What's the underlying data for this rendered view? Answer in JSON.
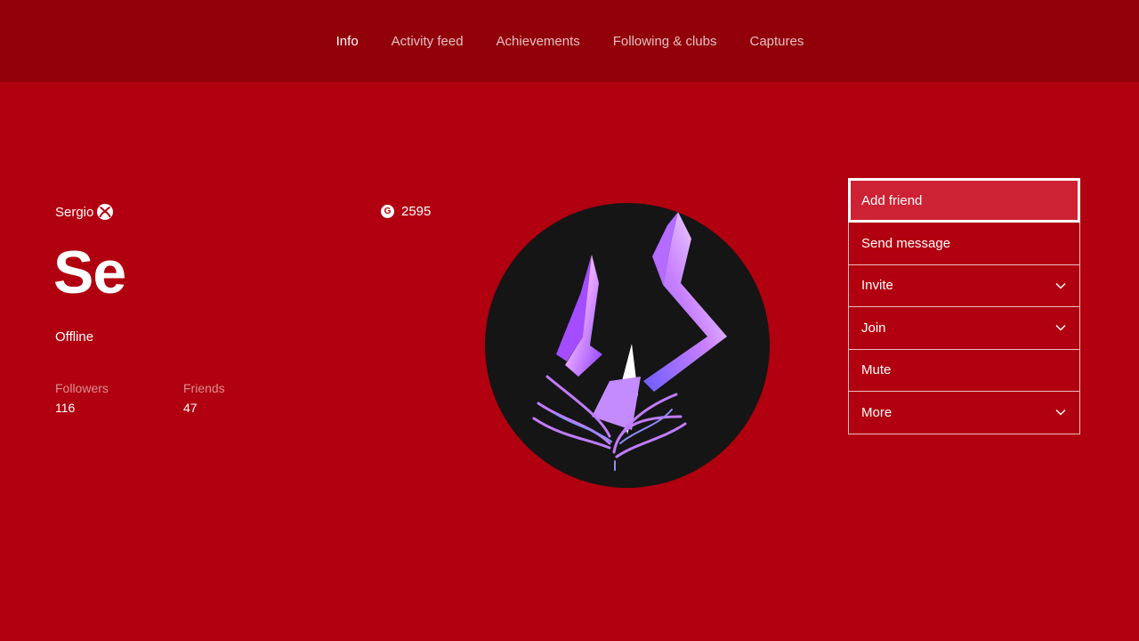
{
  "nav": {
    "tabs": [
      {
        "label": "Info",
        "active": true
      },
      {
        "label": "Activity feed",
        "active": false
      },
      {
        "label": "Achievements",
        "active": false
      },
      {
        "label": "Following & clubs",
        "active": false
      },
      {
        "label": "Captures",
        "active": false
      }
    ]
  },
  "profile": {
    "gamertag": "Sergio",
    "initials": "Se",
    "presence": "Offline",
    "gamerscore_icon": "G",
    "gamerscore": "2595",
    "followers_label": "Followers",
    "followers": "116",
    "friends_label": "Friends",
    "friends": "47"
  },
  "actions": [
    {
      "label": "Add friend",
      "has_dropdown": false,
      "focused": true
    },
    {
      "label": "Send message",
      "has_dropdown": false,
      "focused": false
    },
    {
      "label": "Invite",
      "has_dropdown": true,
      "focused": false
    },
    {
      "label": "Join",
      "has_dropdown": true,
      "focused": false
    },
    {
      "label": "Mute",
      "has_dropdown": false,
      "focused": false
    },
    {
      "label": "More",
      "has_dropdown": true,
      "focused": false
    }
  ],
  "colors": {
    "background": "#b1000f",
    "header": "#920009",
    "focused_button": "#cd2233",
    "avatar_bg": "#151515"
  },
  "icons": {
    "gamertag_badge": "xbox-logo-icon",
    "dropdown": "chevron-down-icon"
  }
}
